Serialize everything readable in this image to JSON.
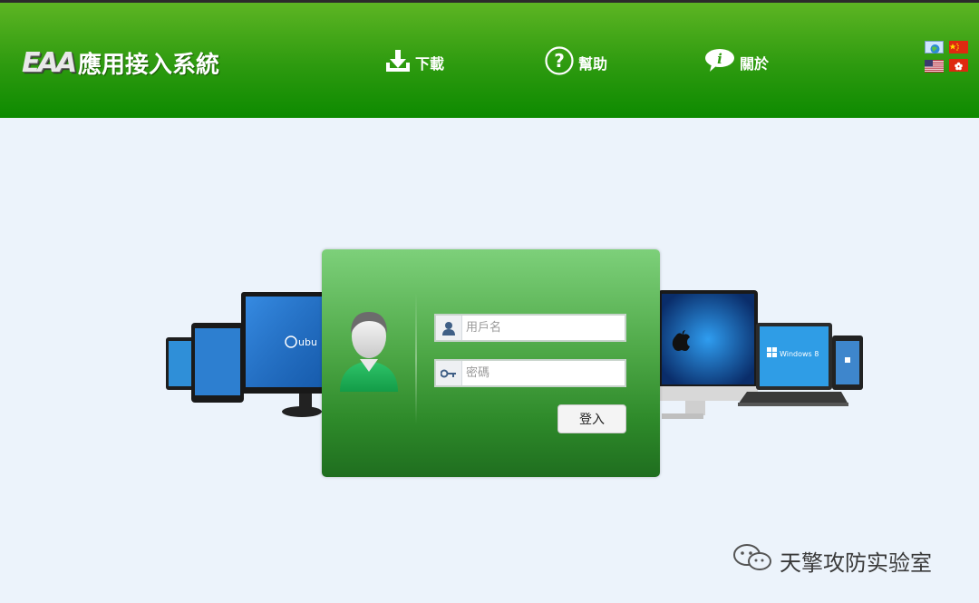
{
  "header": {
    "logo_mark": "EAA",
    "app_title": "應用接入系統",
    "nav": [
      {
        "label": "下載",
        "icon": "download-icon"
      },
      {
        "label": "幫助",
        "icon": "help-icon"
      },
      {
        "label": "關於",
        "icon": "info-icon"
      }
    ],
    "languages": [
      "flag-globe",
      "flag-cn",
      "flag-us",
      "flag-hk"
    ]
  },
  "devices": {
    "left_screen_text": "ubu",
    "right_screen_text": "Windows 8"
  },
  "login": {
    "username_placeholder": "用戶名",
    "password_placeholder": "密碼",
    "submit_label": "登入"
  },
  "watermark": {
    "text": "天擎攻防实验室"
  },
  "colors": {
    "header_green": "#2d9a0f",
    "panel_green": "#4ea847",
    "page_bg": "#ecf3fb"
  }
}
